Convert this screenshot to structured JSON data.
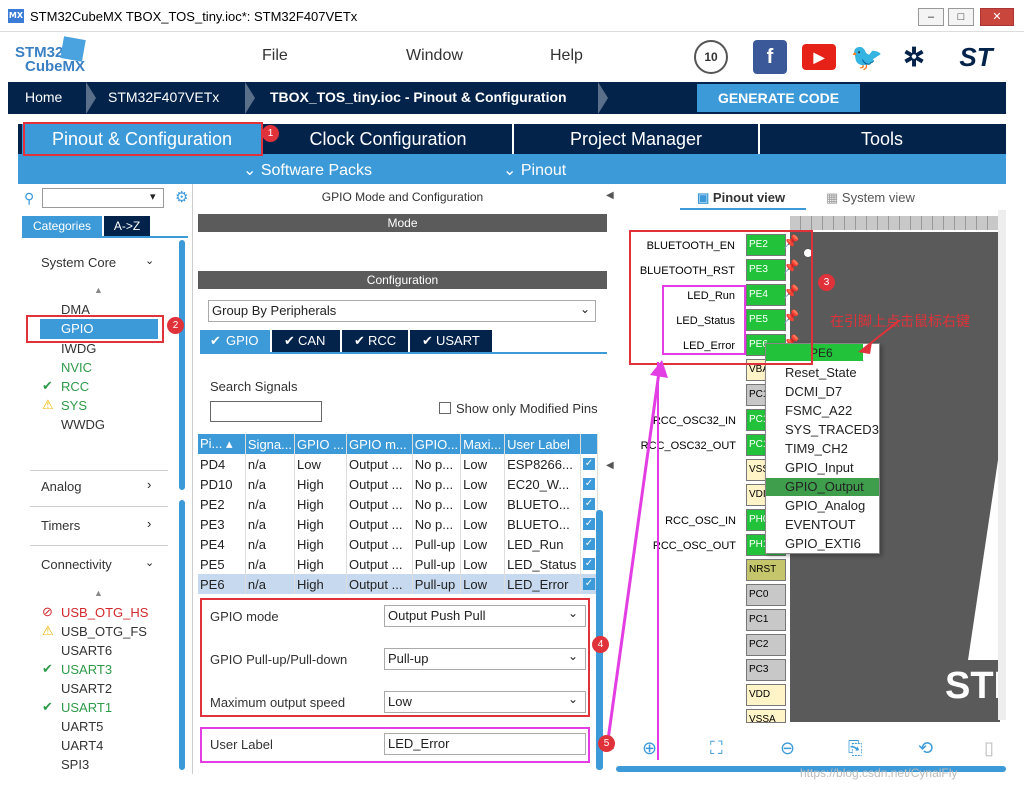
{
  "window": {
    "title": "STM32CubeMX TBOX_TOS_tiny.ioc*: STM32F407VETx",
    "app_icon": "MX",
    "controls": [
      "–",
      "□",
      "✕"
    ]
  },
  "logo": {
    "line1": "STM32",
    "line2": "CubeMX"
  },
  "menu": {
    "file": "File",
    "window": "Window",
    "help": "Help"
  },
  "breadcrumb": {
    "home": "Home",
    "chip": "STM32F407VETx",
    "project": "TBOX_TOS_tiny.ioc - Pinout & Configuration",
    "generate": "GENERATE CODE"
  },
  "tabs": {
    "pinout": "Pinout & Configuration",
    "clock": "Clock Configuration",
    "project": "Project Manager",
    "tools": "Tools"
  },
  "subtabs": {
    "software": "Software Packs",
    "pinout": "Pinout"
  },
  "left": {
    "categories_tab": "Categories",
    "az_tab": "A->Z",
    "system_core": "System Core",
    "system_core_items": [
      "DMA",
      "GPIO",
      "IWDG",
      "NVIC",
      "RCC",
      "SYS",
      "WWDG"
    ],
    "analog": "Analog",
    "timers": "Timers",
    "connectivity": "Connectivity",
    "conn_items": [
      "USB_OTG_HS",
      "USB_OTG_FS",
      "USART6",
      "USART3",
      "USART2",
      "USART1",
      "UART5",
      "UART4",
      "SPI3"
    ]
  },
  "middle": {
    "title": "GPIO Mode and Configuration",
    "mode_header": "Mode",
    "config_header": "Configuration",
    "group_by": "Group By Peripherals",
    "periph_tabs": [
      "GPIO",
      "CAN",
      "RCC",
      "USART"
    ],
    "search_label": "Search Signals",
    "show_modified": "Show only Modified Pins",
    "columns": [
      "Pi...",
      "Signa...",
      "GPIO ...",
      "GPIO m...",
      "GPIO...",
      "Maxi...",
      "User Label",
      ""
    ],
    "rows": [
      [
        "PD4",
        "n/a",
        "Low",
        "Output ...",
        "No p...",
        "Low",
        "ESP8266..."
      ],
      [
        "PD10",
        "n/a",
        "High",
        "Output ...",
        "No p...",
        "Low",
        "EC20_W..."
      ],
      [
        "PE2",
        "n/a",
        "High",
        "Output ...",
        "No p...",
        "Low",
        "BLUETO..."
      ],
      [
        "PE3",
        "n/a",
        "High",
        "Output ...",
        "No p...",
        "Low",
        "BLUETO..."
      ],
      [
        "PE4",
        "n/a",
        "High",
        "Output ...",
        "Pull-up",
        "Low",
        "LED_Run"
      ],
      [
        "PE5",
        "n/a",
        "High",
        "Output ...",
        "Pull-up",
        "Low",
        "LED_Status"
      ],
      [
        "PE6",
        "n/a",
        "High",
        "Output ...",
        "Pull-up",
        "Low",
        "LED_Error"
      ]
    ],
    "gpio_mode_label": "GPIO mode",
    "gpio_mode_value": "Output Push Pull",
    "pull_label": "GPIO Pull-up/Pull-down",
    "pull_value": "Pull-up",
    "speed_label": "Maximum output speed",
    "speed_value": "Low",
    "user_label": "User Label",
    "user_label_value": "LED_Error"
  },
  "right": {
    "pinout_view": "Pinout view",
    "system_view": "System view",
    "pin_labels": [
      "BLUETOOTH_EN",
      "BLUETOOTH_RST",
      "LED_Run",
      "LED_Status",
      "LED_Error"
    ],
    "pins_top": [
      "PE2",
      "PE3",
      "PE4",
      "PE5",
      "PE6"
    ],
    "osc_labels": [
      "RCC_OSC32_IN",
      "RCC_OSC32_OUT",
      "RCC_OSC_IN",
      "RCC_OSC_OUT"
    ],
    "pins_side": [
      "VBA",
      "PC1",
      "PC1",
      "PC1",
      "VSS",
      "VDI",
      "PH0",
      "PH1",
      "NRST",
      "PC0",
      "PC1",
      "PC2",
      "PC3",
      "VDD",
      "VSSA"
    ],
    "chip_text": "STI",
    "context_menu": [
      "PE6",
      "Reset_State",
      "DCMI_D7",
      "FSMC_A22",
      "SYS_TRACED3",
      "TIM9_CH2",
      "GPIO_Input",
      "GPIO_Output",
      "GPIO_Analog",
      "EVENTOUT",
      "GPIO_EXTI6"
    ],
    "annotation": "在引脚上点击鼠标右键",
    "watermark": "https://blog.csdn.net/CynalFly"
  },
  "badges": [
    "1",
    "2",
    "3",
    "4",
    "5"
  ],
  "colors": {
    "navy": "#03234b",
    "accent": "#3d9ad8",
    "pin_green": "#22c23a",
    "highlight_red": "#e0323a",
    "highlight_pink": "#e33ee3"
  }
}
